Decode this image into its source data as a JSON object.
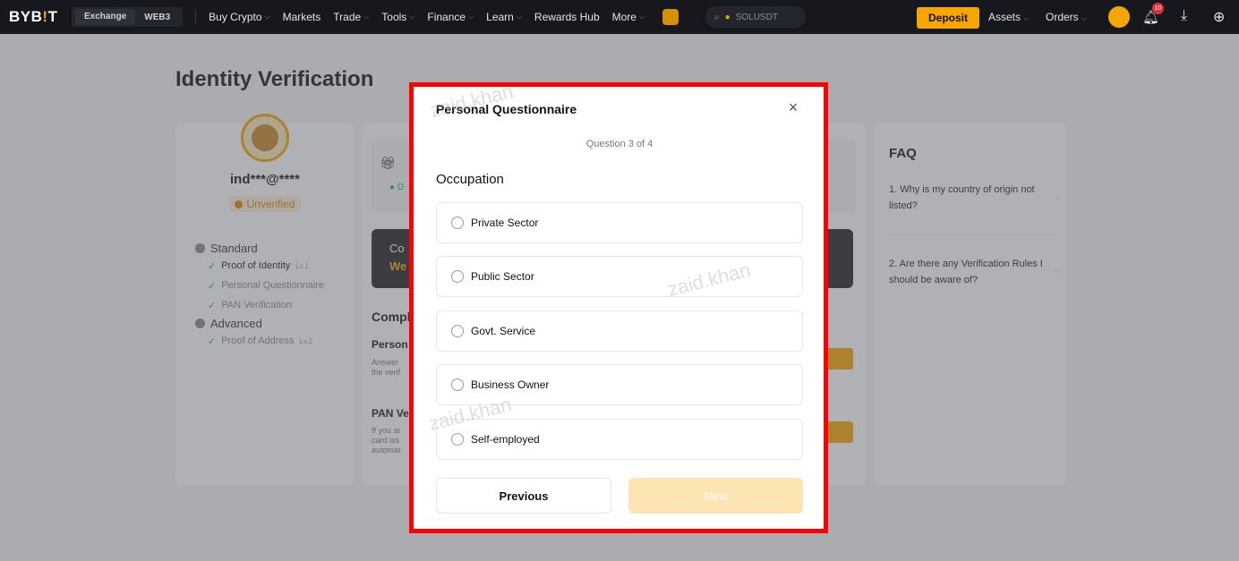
{
  "nav": {
    "logo_part1": "BYB",
    "logo_bang": "!",
    "logo_part2": "T",
    "mode_exchange": "Exchange",
    "mode_web3": "WEB3",
    "items": [
      "Buy Crypto",
      "Markets",
      "Trade",
      "Tools",
      "Finance",
      "Learn",
      "Rewards Hub",
      "More"
    ],
    "search_placeholder": "SOLUSDT",
    "deposit_label": "Deposit",
    "assets_label": "Assets",
    "orders_label": "Orders",
    "notification_count": "10"
  },
  "page": {
    "title": "Identity Verification",
    "user_email": "ind***@****",
    "status_badge": "Unverified",
    "levels": {
      "standard": "Standard",
      "proof_identity": "Proof of Identity",
      "lv1_tag": "Lv.1",
      "personal_questionnaire": "Personal Questionnaire",
      "pan_verification": "PAN Verification",
      "advanced": "Advanced",
      "proof_address": "Proof of Address",
      "lv2_tag": "Lv.2"
    },
    "promo_d": "D",
    "banner_t1": "Co",
    "banner_t2": "We",
    "complete_title": "Compl",
    "section_personal": "Person",
    "section_personal_desc": "Answer the verif",
    "section_pan": "PAN Ve",
    "section_pan_desc": "If you ar card iss automat"
  },
  "faq": {
    "title": "FAQ",
    "q1": "1. Why is my country of origin not listed?",
    "q2": "2. Are there any Verification Rules I should be aware of?"
  },
  "watermark_text": "zaid.khan",
  "modal": {
    "title": "Personal Questionnaire",
    "counter": "Question 3 of 4",
    "question": "Occupation",
    "options": [
      "Private Sector",
      "Public Sector",
      "Govt. Service",
      "Business Owner",
      "Self-employed"
    ],
    "prev_label": "Previous",
    "next_label": "Next"
  },
  "colors": {
    "brand": "#f7a600",
    "highlight": "#ff0000",
    "nav_bg": "#17181e"
  }
}
